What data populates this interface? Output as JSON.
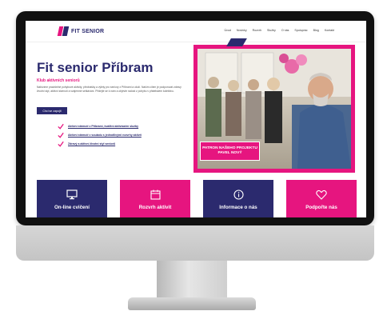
{
  "header": {
    "logo_text": "FIT SENIOR",
    "nav": [
      "Úvod",
      "Novinky",
      "Rozvrh",
      "Služby",
      "O nás",
      "Spoluprác",
      "Blog",
      "Kontakt"
    ]
  },
  "hero": {
    "title": "Fit senior Příbram",
    "subtitle": "Klub aktivních seniorů",
    "body": "Nabízíme pravidelné pohybové aktivity, přednášky a výlety pro seniory z Příbrami a okolí. Naším cílem je podporovat zdravý životní styl, aktivní stárnutí a vzájemné setkávání. Přidejte se k nám a objevte radost z pohybu v přátelském kolektivu.",
    "button_label": "Chci se zapojit",
    "checklist": [
      "Aktivní stárnutí v Příbrami, kvalitní aktivizační služby",
      "Aktivní stárnutí v souladu s jednotlivými rozvrhy aktivit",
      "Zdravý a aktivní životní styl seniorů"
    ]
  },
  "photo": {
    "caption_lines": [
      "PATRON NAŠEHO PROJEKTU",
      "PAVEL NOVÝ"
    ]
  },
  "cards": [
    {
      "label": "On-line cvičení",
      "icon": "monitor-icon",
      "color": "#2b2a6e"
    },
    {
      "label": "Rozvrh aktivit",
      "icon": "calendar-icon",
      "color": "#e6157f"
    },
    {
      "label": "Informace o nás",
      "icon": "info-icon",
      "color": "#2b2a6e"
    },
    {
      "label": "Podpořte nás",
      "icon": "heart-icon",
      "color": "#e6157f"
    }
  ],
  "colors": {
    "navy": "#2b2a6e",
    "pink": "#e6157f"
  }
}
